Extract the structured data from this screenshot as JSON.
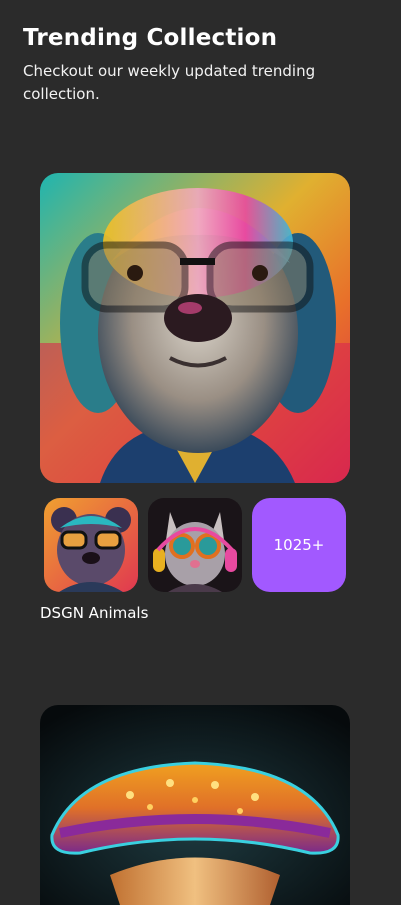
{
  "header": {
    "title": "Trending Collection",
    "subtitle": "Checkout our weekly updated trending collection."
  },
  "collections": [
    {
      "name": "DSGN Animals",
      "more_count": "1025+",
      "main_image": "dog-with-glasses-image",
      "thumbnails": [
        "bear-with-glasses-image",
        "cat-with-goggles-image"
      ]
    },
    {
      "main_image": "mushroom-image"
    }
  ],
  "colors": {
    "background": "#2b2b2b",
    "accent": "#a259ff",
    "text": "#ffffff"
  }
}
